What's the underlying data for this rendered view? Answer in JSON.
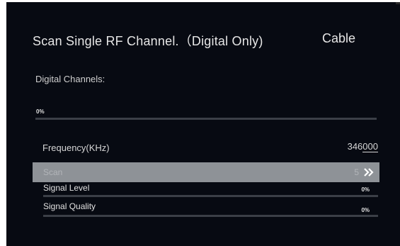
{
  "screen": {
    "title": "Scan Single RF Channel.（Digital Only)",
    "source": "Cable"
  },
  "digital": {
    "label": "Digital Channels:",
    "progress_text": "0%",
    "progress_value": 0
  },
  "frequency": {
    "label": "Frequency(KHz)",
    "value_prefix": "346",
    "value_underlined": "000"
  },
  "scan": {
    "label": "Scan",
    "count": "5",
    "arrow_icon": "double-chevron-right-icon"
  },
  "signal_level": {
    "label": "Signal Level",
    "percent_text": "0%",
    "value": 0
  },
  "signal_quality": {
    "label": "Signal Quality",
    "percent_text": "0%",
    "value": 0
  },
  "colors": {
    "background": "#070a12",
    "highlight_row": "#8e9297",
    "track": "#3b3f47",
    "text": "#e6e6e6"
  }
}
